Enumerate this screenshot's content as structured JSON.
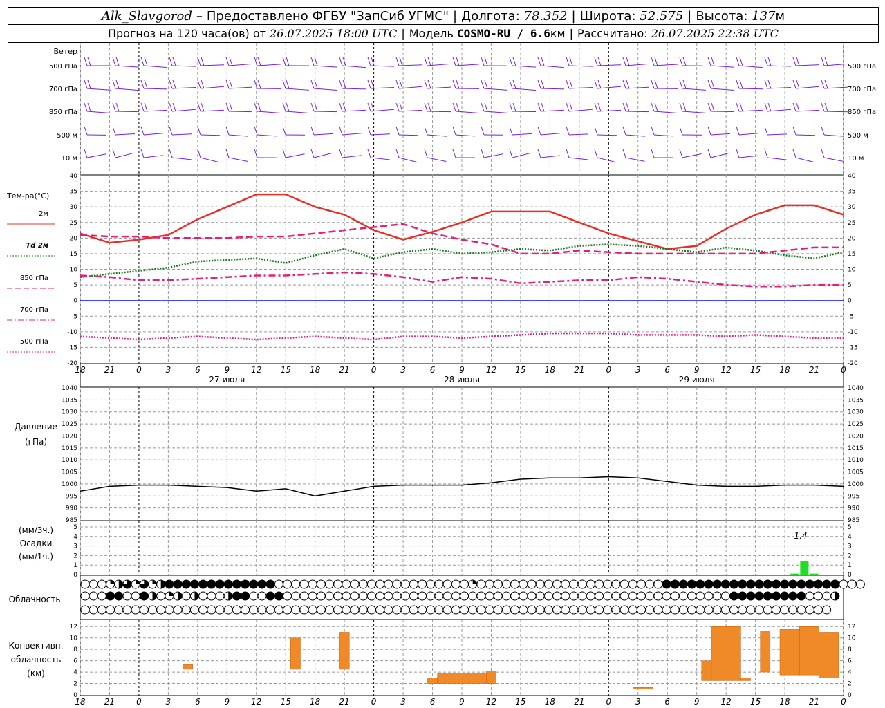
{
  "header": {
    "station": "Alk_Slavgorod",
    "dash": "–",
    "provider": "Предоставлено ФГБУ \"ЗапСиб УГМС\"",
    "lon_label": "Долгота:",
    "lon_value": "78.352",
    "lat_label": "Широта:",
    "lat_value": "52.575",
    "alt_label": "Высота:",
    "alt_value": "137",
    "alt_unit": "м",
    "forecast_prefix": "Прогноз на 120 часа(ов) от",
    "forecast_start": "26.07.2025 18:00 UTC",
    "model_label": "Модель",
    "model_name": "COSMO-RU / 6.6",
    "model_unit": "км",
    "calc_label": "Рассчитано:",
    "calc_time": "26.07.2025 22:38 UTC"
  },
  "panels": {
    "wind": {
      "title": "Ветер",
      "levels": [
        "500 гПа",
        "700 гПа",
        "850 гПа",
        "500 м",
        "10 м"
      ],
      "color": "#7a1fd6"
    },
    "temp": {
      "title": "Тем-ра(°C)",
      "legend": [
        "2м",
        "Td 2м",
        "850 гПа",
        "700 гПа",
        "500 гПа"
      ]
    },
    "pressure": {
      "title1": "Давление",
      "title2": "(гПа)"
    },
    "precip": {
      "title1": "(мм/3ч.)",
      "title2": "Осадки",
      "title3": "(мм/1ч.)",
      "max_label": "1.4"
    },
    "clouds": {
      "title": "Облачность"
    },
    "convective": {
      "title1": "Конвективн.",
      "title2": "облачность",
      "title3": "(км)"
    }
  },
  "axis": {
    "hour_ticks": [
      "18",
      "21",
      "0",
      "3",
      "6",
      "9",
      "12",
      "15",
      "18",
      "21",
      "0",
      "3",
      "6",
      "9",
      "12",
      "15",
      "18",
      "21",
      "0",
      "3",
      "6",
      "9",
      "12",
      "15",
      "18",
      "21",
      "0"
    ],
    "dates": [
      "27 июля",
      "28 июля",
      "29 июля"
    ]
  },
  "chart_data": [
    {
      "type": "line",
      "title": "Тем-ра(°C)",
      "x_hours": [
        0,
        3,
        6,
        9,
        12,
        15,
        18,
        21,
        24,
        27,
        30,
        33,
        36,
        39,
        42,
        45,
        48,
        51,
        54,
        57,
        60,
        63,
        66,
        69,
        72,
        75,
        78
      ],
      "ylim": [
        -20,
        40
      ],
      "yticks": [
        -20,
        -15,
        -10,
        -5,
        0,
        5,
        10,
        15,
        20,
        25,
        30,
        35,
        40
      ],
      "series": [
        {
          "name": "2м",
          "color": "#e8302a",
          "style": "solid",
          "values": [
            21.5,
            18.5,
            19.5,
            21,
            26,
            30,
            34,
            34,
            30,
            27.5,
            22.5,
            19.5,
            22,
            25,
            28.5,
            28.5,
            28.5,
            25,
            21.5,
            19,
            16.5,
            17.5,
            23,
            27.5,
            30.5,
            30.5,
            27.5
          ]
        },
        {
          "name": "Td 2м",
          "color": "#1a7a1a",
          "style": "dotted",
          "values": [
            7.5,
            8.5,
            9.5,
            10.5,
            12.5,
            13,
            13.5,
            12,
            14.5,
            16.5,
            13.5,
            15.5,
            16.5,
            15,
            15.5,
            16.5,
            16,
            17.5,
            18,
            17.5,
            16.5,
            15.5,
            17,
            16,
            14.5,
            13.5,
            15.5
          ]
        },
        {
          "name": "850 гПа",
          "color": "#e0207a",
          "style": "dashed",
          "values": [
            21,
            20.5,
            20.5,
            20,
            20,
            20,
            20.5,
            20.5,
            21.5,
            22.5,
            23.5,
            24.5,
            21.5,
            19.5,
            18,
            15,
            15,
            16,
            15.5,
            15,
            15,
            15,
            15,
            15,
            16,
            17,
            17
          ]
        },
        {
          "name": "700 гПа",
          "color": "#e0207a",
          "style": "dashdot",
          "values": [
            8,
            7.5,
            6.5,
            6.5,
            7,
            7.5,
            8,
            8,
            8.5,
            9,
            8.5,
            7.5,
            6,
            7.5,
            7,
            5.5,
            6,
            6.5,
            6.5,
            7.5,
            7,
            6,
            5,
            4.5,
            4.5,
            5,
            5
          ]
        },
        {
          "name": "500 гПа",
          "color": "#e0207a",
          "style": "dotted",
          "values": [
            -11.5,
            -12,
            -12.5,
            -12,
            -11.5,
            -12,
            -12.5,
            -12,
            -11.5,
            -12,
            -12.5,
            -11.5,
            -11.5,
            -12,
            -11.5,
            -11,
            -10.5,
            -10.5,
            -10.5,
            -11,
            -11,
            -11,
            -11.5,
            -11,
            -11.5,
            -12,
            -12
          ]
        }
      ]
    },
    {
      "type": "line",
      "title": "Давление",
      "ylabel": "(гПа)",
      "x_hours": [
        0,
        3,
        6,
        9,
        12,
        15,
        18,
        21,
        24,
        27,
        30,
        33,
        36,
        39,
        42,
        45,
        48,
        51,
        54,
        57,
        60,
        63,
        66,
        69,
        72,
        75,
        78
      ],
      "ylim": [
        985,
        1040
      ],
      "yticks": [
        985,
        990,
        995,
        1000,
        1005,
        1010,
        1015,
        1020,
        1025,
        1030,
        1035,
        1040
      ],
      "series": [
        {
          "name": "pressure",
          "color": "#000000",
          "values": [
            997,
            999,
            999.5,
            999.5,
            999,
            998.5,
            997,
            998,
            995,
            997,
            999,
            999.5,
            999.5,
            999.5,
            1000.5,
            1002,
            1002.5,
            1002.5,
            1003,
            1002.5,
            1001,
            999.5,
            999,
            999,
            999.5,
            999.5,
            999
          ]
        }
      ]
    },
    {
      "type": "bar",
      "title": "Осадки",
      "ylim": [
        0,
        5
      ],
      "yticks": [
        0,
        1,
        2,
        3,
        4,
        5
      ],
      "x_hours": [
        73,
        74,
        75
      ],
      "values": [
        0.1,
        1.4,
        0.1
      ],
      "color": "#22dd22"
    },
    {
      "type": "bar",
      "title": "Конвективн. облачность",
      "ylabel": "(км)",
      "ylim": [
        0,
        13
      ],
      "yticks": [
        0,
        2,
        4,
        6,
        8,
        10,
        12
      ],
      "color": "#f08a28",
      "bars": [
        {
          "x0": 10.5,
          "x1": 11.5,
          "base": 4.5,
          "top": 5.3
        },
        {
          "x0": 21.5,
          "x1": 22.5,
          "base": 4.5,
          "top": 10
        },
        {
          "x0": 26.5,
          "x1": 27.5,
          "base": 4.5,
          "top": 11
        },
        {
          "x0": 35.5,
          "x1": 36.5,
          "base": 2,
          "top": 3
        },
        {
          "x0": 36.5,
          "x1": 41.5,
          "base": 2,
          "top": 3.8
        },
        {
          "x0": 41.5,
          "x1": 42.5,
          "base": 2,
          "top": 4.2
        },
        {
          "x0": 56.5,
          "x1": 58.5,
          "base": 1,
          "top": 1.3
        },
        {
          "x0": 63.5,
          "x1": 64.5,
          "base": 2.5,
          "top": 6
        },
        {
          "x0": 64.5,
          "x1": 67.5,
          "base": 2.5,
          "top": 12
        },
        {
          "x0": 67.5,
          "x1": 68.5,
          "base": 2.5,
          "top": 3
        },
        {
          "x0": 69.5,
          "x1": 70.5,
          "base": 4,
          "top": 11.2
        },
        {
          "x0": 71.5,
          "x1": 73.5,
          "base": 3.5,
          "top": 11.5
        },
        {
          "x0": 73.5,
          "x1": 75.5,
          "base": 3.5,
          "top": 12
        },
        {
          "x0": 75.5,
          "x1": 77.5,
          "base": 3,
          "top": 11
        }
      ]
    }
  ],
  "cloud_rows": [
    "eeeqhtqtqhfffffffffffffeeeeeeeeeeeeeeeeeeeeeeeqeeeeeeeeeeeeeeeeeeeeeefffffffffffffffffffffeee",
    "eeeffeefheqheheeehffeeffeeeeeeeeeeeeeeeeeeeeeeeeeeeeeeeeeeeeeeeeeeeeeeeeeeeeefffffffffeeeh",
    "eeeeeeeeeeeeeeeeeeeeeeeeeeeeeeeeeeeeeeeeeeeeeeeeeeeeeeeeeeeeeeeeeeeeeeeeeeeeeeeeeeeeeeeee"
  ]
}
